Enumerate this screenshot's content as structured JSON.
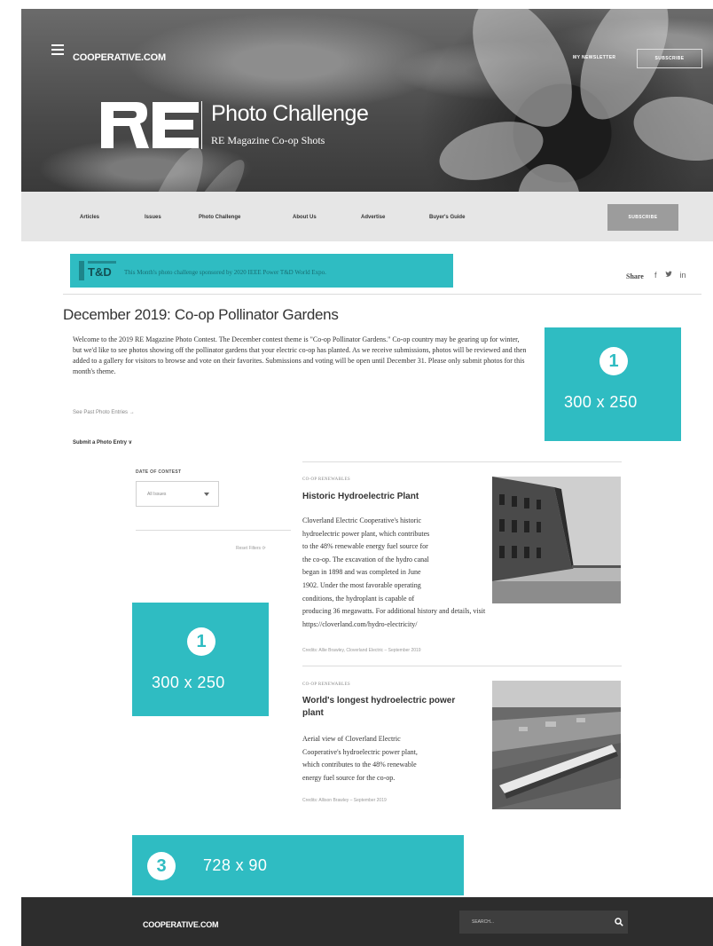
{
  "header": {
    "brand": "COOPERATIVE.COM",
    "login_label": "MY NEWSLETTER",
    "subscribe_label": "SUBSCRIBE",
    "title": "Photo Challenge",
    "subtitle": "RE Magazine Co-op Shots"
  },
  "nav": {
    "items": [
      {
        "label": "Articles"
      },
      {
        "label": "Issues"
      },
      {
        "label": "Photo Challenge"
      },
      {
        "label": "About Us"
      },
      {
        "label": "Advertise"
      },
      {
        "label": "Buyer's Guide"
      }
    ],
    "subscribe_label": "SUBSCRIBE"
  },
  "sponsor": {
    "text": "This Month's photo challenge sponsored by 2020 IEEE Power T&D World Expo."
  },
  "share": {
    "label": "Share"
  },
  "page": {
    "title": "December 2019: Co-op Pollinator Gardens",
    "intro": "Welcome to the 2019 RE Magazine Photo Contest. The December contest theme is \"Co-op Pollinator Gardens.\" Co-op country may be gearing up for winter, but we'd like to see photos showing off the pollinator gardens that your electric co-op has planted. As we receive submissions, photos will be reviewed and then added to a gallery for visitors to browse and vote on their favorites. Submissions and voting will be open until December 31. Please only submit photos for this month's theme.",
    "see_past": "See Past Photo Entries →",
    "submit_entry": "Submit a Photo Entry ∨"
  },
  "ads": [
    {
      "number": "1",
      "size": "300 x 250"
    },
    {
      "number": "1",
      "size": "300 x 250"
    },
    {
      "number": "3",
      "size": "728 x 90"
    }
  ],
  "filter": {
    "label": "DATE OF CONTEST",
    "value": "All Issues",
    "reset_label": "Reset Filters ⟳"
  },
  "articles": [
    {
      "category": "CO-OP RENEWABLES",
      "title": "Historic Hydroelectric Plant",
      "lines": [
        "Cloverland Electric Cooperative's historic",
        "hydroelectric power plant, which contributes",
        "to the 48% renewable energy fuel source for",
        "the co-op. The excavation of the hydro canal",
        "began in 1898 and was completed in June",
        "1902. Under the most favorable operating",
        "conditions, the hydroplant is capable of",
        "producing 36 megawatts. For additional history and details, visit",
        "https://cloverland.com/hydro-electricity/"
      ],
      "credit": "Credits: Allie Brawley, Cloverland Electric – September 2019"
    },
    {
      "category": "CO-OP RENEWABLES",
      "title_lines": [
        "World's longest hydroelectric power",
        "plant"
      ],
      "lines": [
        "Aerial view of Cloverland Electric",
        "Cooperative's hydroelectric power plant,",
        "which contributes to the 48% renewable",
        "energy fuel source for the co-op."
      ],
      "credit": "Credits: Allison Brawley – September 2019"
    }
  ],
  "footer": {
    "brand": "COOPERATIVE.COM",
    "search_placeholder": "SEARCH..."
  },
  "colors": {
    "ad_accent": "#2fbcc2",
    "footer_bg": "#2d2d2d",
    "nav_bg": "#e6e6e6"
  }
}
